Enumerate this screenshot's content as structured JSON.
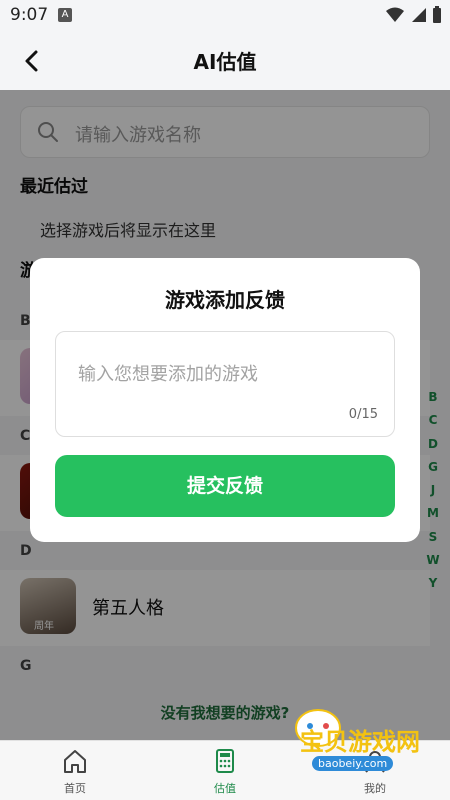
{
  "status_bar": {
    "time": "9:07",
    "a_badge": "A"
  },
  "header": {
    "title": "AI估值"
  },
  "search": {
    "placeholder": "请输入游戏名称"
  },
  "recent": {
    "title": "最近估过",
    "hint": "选择游戏后将显示在这里"
  },
  "game_list": {
    "title": "游戏列表",
    "letters": {
      "b": "B",
      "c": "C",
      "d": "D",
      "g": "G"
    },
    "rows": [
      {
        "letter": "D",
        "name": "第五人格",
        "thumb_caption": "周年"
      }
    ]
  },
  "index_bar": [
    "B",
    "C",
    "D",
    "G",
    "J",
    "M",
    "S",
    "W",
    "Y"
  ],
  "missing_game_link": "没有我想要的游戏?",
  "bottom_nav": [
    {
      "label": "首页",
      "icon": "home-icon"
    },
    {
      "label": "估值",
      "icon": "calculator-icon"
    },
    {
      "label": "我的",
      "icon": "profile-icon"
    }
  ],
  "dialog": {
    "title": "游戏添加反馈",
    "input_placeholder": "输入您想要添加的游戏",
    "counter": "0/15",
    "submit_label": "提交反馈"
  },
  "watermark": {
    "text": "宝贝游戏网",
    "url": "baobeiy.com"
  },
  "colors": {
    "accent": "#26c05f",
    "link": "#1f6d3c",
    "background": "#f4f5f7"
  }
}
